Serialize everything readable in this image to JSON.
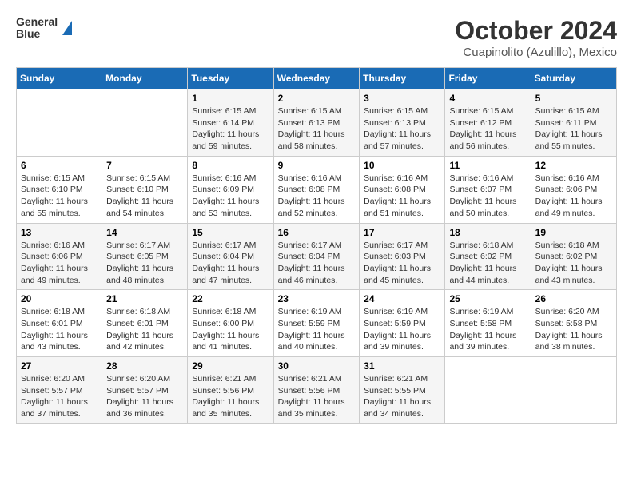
{
  "header": {
    "logo_line1": "General",
    "logo_line2": "Blue",
    "title": "October 2024",
    "subtitle": "Cuapinolito (Azulillo), Mexico"
  },
  "columns": [
    "Sunday",
    "Monday",
    "Tuesday",
    "Wednesday",
    "Thursday",
    "Friday",
    "Saturday"
  ],
  "weeks": [
    [
      {
        "day": "",
        "sunrise": "",
        "sunset": "",
        "daylight": ""
      },
      {
        "day": "",
        "sunrise": "",
        "sunset": "",
        "daylight": ""
      },
      {
        "day": "1",
        "sunrise": "Sunrise: 6:15 AM",
        "sunset": "Sunset: 6:14 PM",
        "daylight": "Daylight: 11 hours and 59 minutes."
      },
      {
        "day": "2",
        "sunrise": "Sunrise: 6:15 AM",
        "sunset": "Sunset: 6:13 PM",
        "daylight": "Daylight: 11 hours and 58 minutes."
      },
      {
        "day": "3",
        "sunrise": "Sunrise: 6:15 AM",
        "sunset": "Sunset: 6:13 PM",
        "daylight": "Daylight: 11 hours and 57 minutes."
      },
      {
        "day": "4",
        "sunrise": "Sunrise: 6:15 AM",
        "sunset": "Sunset: 6:12 PM",
        "daylight": "Daylight: 11 hours and 56 minutes."
      },
      {
        "day": "5",
        "sunrise": "Sunrise: 6:15 AM",
        "sunset": "Sunset: 6:11 PM",
        "daylight": "Daylight: 11 hours and 55 minutes."
      }
    ],
    [
      {
        "day": "6",
        "sunrise": "Sunrise: 6:15 AM",
        "sunset": "Sunset: 6:10 PM",
        "daylight": "Daylight: 11 hours and 55 minutes."
      },
      {
        "day": "7",
        "sunrise": "Sunrise: 6:15 AM",
        "sunset": "Sunset: 6:10 PM",
        "daylight": "Daylight: 11 hours and 54 minutes."
      },
      {
        "day": "8",
        "sunrise": "Sunrise: 6:16 AM",
        "sunset": "Sunset: 6:09 PM",
        "daylight": "Daylight: 11 hours and 53 minutes."
      },
      {
        "day": "9",
        "sunrise": "Sunrise: 6:16 AM",
        "sunset": "Sunset: 6:08 PM",
        "daylight": "Daylight: 11 hours and 52 minutes."
      },
      {
        "day": "10",
        "sunrise": "Sunrise: 6:16 AM",
        "sunset": "Sunset: 6:08 PM",
        "daylight": "Daylight: 11 hours and 51 minutes."
      },
      {
        "day": "11",
        "sunrise": "Sunrise: 6:16 AM",
        "sunset": "Sunset: 6:07 PM",
        "daylight": "Daylight: 11 hours and 50 minutes."
      },
      {
        "day": "12",
        "sunrise": "Sunrise: 6:16 AM",
        "sunset": "Sunset: 6:06 PM",
        "daylight": "Daylight: 11 hours and 49 minutes."
      }
    ],
    [
      {
        "day": "13",
        "sunrise": "Sunrise: 6:16 AM",
        "sunset": "Sunset: 6:06 PM",
        "daylight": "Daylight: 11 hours and 49 minutes."
      },
      {
        "day": "14",
        "sunrise": "Sunrise: 6:17 AM",
        "sunset": "Sunset: 6:05 PM",
        "daylight": "Daylight: 11 hours and 48 minutes."
      },
      {
        "day": "15",
        "sunrise": "Sunrise: 6:17 AM",
        "sunset": "Sunset: 6:04 PM",
        "daylight": "Daylight: 11 hours and 47 minutes."
      },
      {
        "day": "16",
        "sunrise": "Sunrise: 6:17 AM",
        "sunset": "Sunset: 6:04 PM",
        "daylight": "Daylight: 11 hours and 46 minutes."
      },
      {
        "day": "17",
        "sunrise": "Sunrise: 6:17 AM",
        "sunset": "Sunset: 6:03 PM",
        "daylight": "Daylight: 11 hours and 45 minutes."
      },
      {
        "day": "18",
        "sunrise": "Sunrise: 6:18 AM",
        "sunset": "Sunset: 6:02 PM",
        "daylight": "Daylight: 11 hours and 44 minutes."
      },
      {
        "day": "19",
        "sunrise": "Sunrise: 6:18 AM",
        "sunset": "Sunset: 6:02 PM",
        "daylight": "Daylight: 11 hours and 43 minutes."
      }
    ],
    [
      {
        "day": "20",
        "sunrise": "Sunrise: 6:18 AM",
        "sunset": "Sunset: 6:01 PM",
        "daylight": "Daylight: 11 hours and 43 minutes."
      },
      {
        "day": "21",
        "sunrise": "Sunrise: 6:18 AM",
        "sunset": "Sunset: 6:01 PM",
        "daylight": "Daylight: 11 hours and 42 minutes."
      },
      {
        "day": "22",
        "sunrise": "Sunrise: 6:18 AM",
        "sunset": "Sunset: 6:00 PM",
        "daylight": "Daylight: 11 hours and 41 minutes."
      },
      {
        "day": "23",
        "sunrise": "Sunrise: 6:19 AM",
        "sunset": "Sunset: 5:59 PM",
        "daylight": "Daylight: 11 hours and 40 minutes."
      },
      {
        "day": "24",
        "sunrise": "Sunrise: 6:19 AM",
        "sunset": "Sunset: 5:59 PM",
        "daylight": "Daylight: 11 hours and 39 minutes."
      },
      {
        "day": "25",
        "sunrise": "Sunrise: 6:19 AM",
        "sunset": "Sunset: 5:58 PM",
        "daylight": "Daylight: 11 hours and 39 minutes."
      },
      {
        "day": "26",
        "sunrise": "Sunrise: 6:20 AM",
        "sunset": "Sunset: 5:58 PM",
        "daylight": "Daylight: 11 hours and 38 minutes."
      }
    ],
    [
      {
        "day": "27",
        "sunrise": "Sunrise: 6:20 AM",
        "sunset": "Sunset: 5:57 PM",
        "daylight": "Daylight: 11 hours and 37 minutes."
      },
      {
        "day": "28",
        "sunrise": "Sunrise: 6:20 AM",
        "sunset": "Sunset: 5:57 PM",
        "daylight": "Daylight: 11 hours and 36 minutes."
      },
      {
        "day": "29",
        "sunrise": "Sunrise: 6:21 AM",
        "sunset": "Sunset: 5:56 PM",
        "daylight": "Daylight: 11 hours and 35 minutes."
      },
      {
        "day": "30",
        "sunrise": "Sunrise: 6:21 AM",
        "sunset": "Sunset: 5:56 PM",
        "daylight": "Daylight: 11 hours and 35 minutes."
      },
      {
        "day": "31",
        "sunrise": "Sunrise: 6:21 AM",
        "sunset": "Sunset: 5:55 PM",
        "daylight": "Daylight: 11 hours and 34 minutes."
      },
      {
        "day": "",
        "sunrise": "",
        "sunset": "",
        "daylight": ""
      },
      {
        "day": "",
        "sunrise": "",
        "sunset": "",
        "daylight": ""
      }
    ]
  ]
}
